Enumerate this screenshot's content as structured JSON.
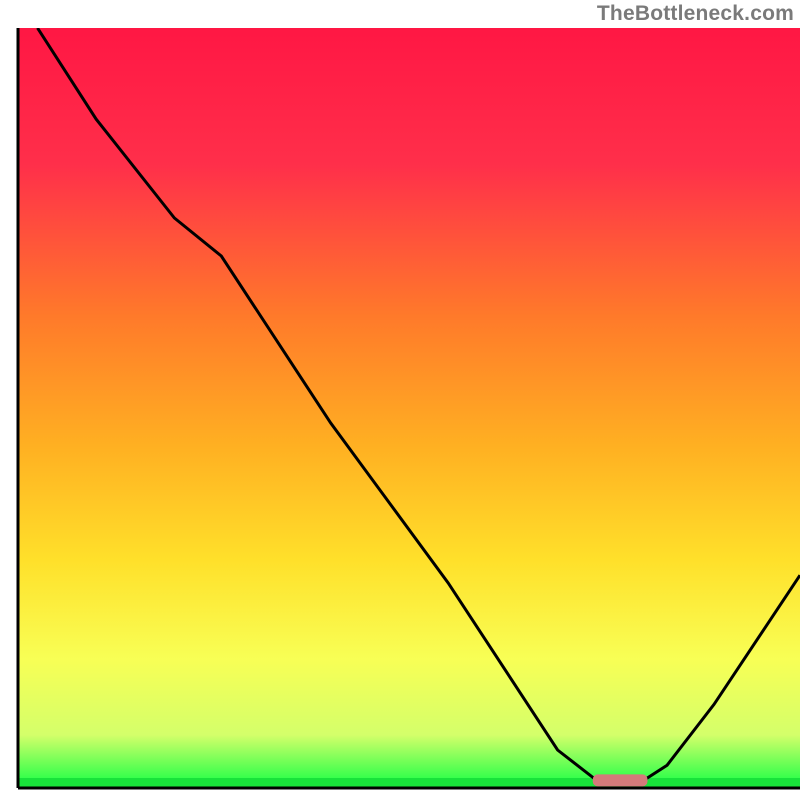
{
  "watermark": "TheBottleneck.com",
  "chart_data": {
    "type": "line",
    "title": "",
    "xlabel": "",
    "ylabel": "",
    "xlim": [
      0,
      100
    ],
    "ylim": [
      0,
      100
    ],
    "series": [
      {
        "name": "bottleneck-curve",
        "x": [
          2.5,
          10,
          20,
          26,
          40,
          55,
          69,
          74,
          80,
          83,
          89,
          100
        ],
        "values": [
          100,
          88,
          75,
          70,
          48,
          27,
          5,
          1,
          1,
          3,
          11,
          28
        ]
      }
    ],
    "marker": {
      "name": "optimal-range",
      "x_center": 77,
      "y": 1,
      "width": 7,
      "color": "#d47a7a"
    },
    "gradient_bands": [
      {
        "pos": 0.0,
        "color": "#ff1744"
      },
      {
        "pos": 0.18,
        "color": "#ff2f4a"
      },
      {
        "pos": 0.38,
        "color": "#ff7a2a"
      },
      {
        "pos": 0.55,
        "color": "#ffb022"
      },
      {
        "pos": 0.7,
        "color": "#ffe02a"
      },
      {
        "pos": 0.83,
        "color": "#f8ff55"
      },
      {
        "pos": 0.93,
        "color": "#d4ff6a"
      },
      {
        "pos": 0.99,
        "color": "#2eff4a"
      }
    ],
    "axis_color": "#000000",
    "line_color": "#000000",
    "line_width": 3
  }
}
